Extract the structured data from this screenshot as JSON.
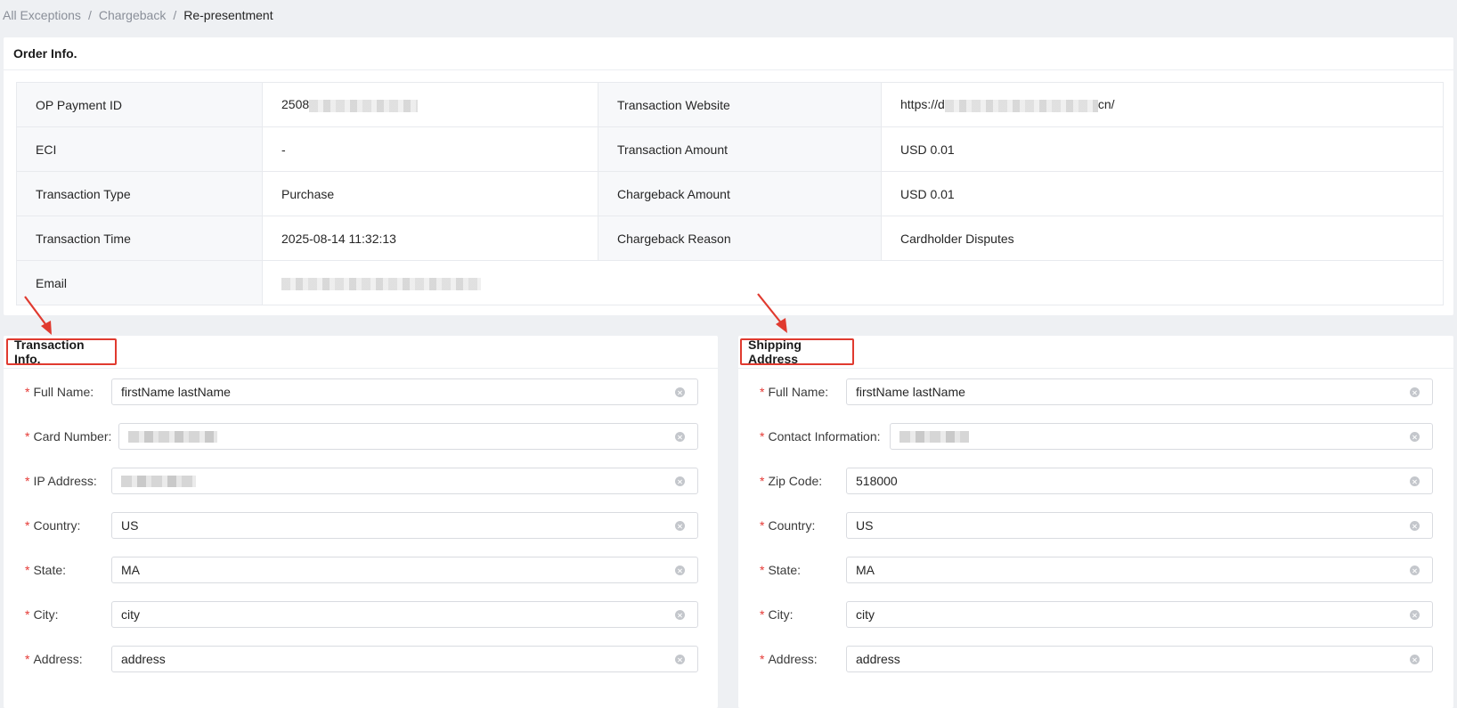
{
  "breadcrumb": {
    "items": [
      "All Exceptions",
      "Chargeback"
    ],
    "separator": "/",
    "current": "Re-presentment"
  },
  "order_info": {
    "title": "Order Info.",
    "rows": [
      {
        "label1": "OP Payment ID",
        "value1": "2508",
        "label2": "Transaction Website",
        "value2_prefix": "https://d",
        "value2_suffix": "cn/"
      },
      {
        "label1": "ECI",
        "value1": "-",
        "label2": "Transaction Amount",
        "value2": "USD 0.01"
      },
      {
        "label1": "Transaction Type",
        "value1": "Purchase",
        "label2": "Chargeback Amount",
        "value2": "USD 0.01"
      },
      {
        "label1": "Transaction Time",
        "value1": "2025-08-14 11:32:13",
        "label2": "Chargeback Reason",
        "value2": "Cardholder Disputes"
      },
      {
        "label1": "Email"
      }
    ]
  },
  "transaction_info": {
    "title": "Transaction Info.",
    "fields": [
      {
        "label": "Full Name:",
        "value": "firstName lastName"
      },
      {
        "label": "Card Number:",
        "value": ""
      },
      {
        "label": "IP Address:",
        "value": ""
      },
      {
        "label": "Country:",
        "value": "US"
      },
      {
        "label": "State:",
        "value": "MA"
      },
      {
        "label": "City:",
        "value": "city"
      },
      {
        "label": "Address:",
        "value": "address"
      }
    ]
  },
  "shipping_address": {
    "title": "Shipping Address",
    "fields": [
      {
        "label": "Full Name:",
        "value": "firstName lastName"
      },
      {
        "label": "Contact Information:",
        "value": ""
      },
      {
        "label": "Zip Code:",
        "value": "518000"
      },
      {
        "label": "Country:",
        "value": "US"
      },
      {
        "label": "State:",
        "value": "MA"
      },
      {
        "label": "City:",
        "value": "city"
      },
      {
        "label": "Address:",
        "value": "address"
      }
    ]
  },
  "required_mark": "*",
  "colors": {
    "highlight": "#e03a2f",
    "required": "#e53935",
    "page_bg": "#eef0f3"
  },
  "icons": [
    "clear-icon",
    "annotation-arrow-icon"
  ]
}
